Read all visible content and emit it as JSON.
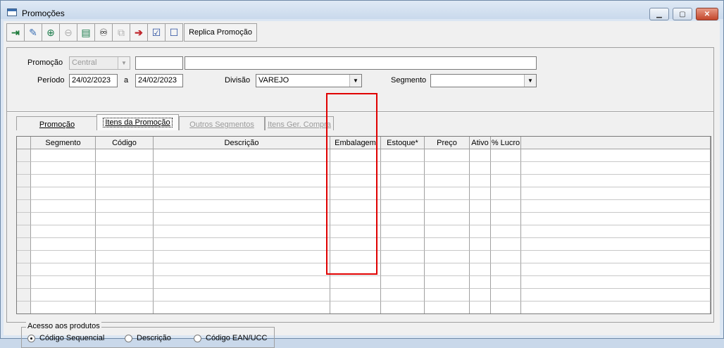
{
  "window": {
    "title": "Promoções"
  },
  "toolbar": {
    "buttons": [
      {
        "icon": "exit-door-icon",
        "glyph": "⇥"
      },
      {
        "icon": "eraser-icon",
        "glyph": "✎"
      },
      {
        "icon": "add-item-icon",
        "glyph": "⊕"
      },
      {
        "icon": "remove-item-icon",
        "glyph": "⊖"
      },
      {
        "icon": "spreadsheet-icon",
        "glyph": "▤"
      },
      {
        "icon": "binoculars-icon",
        "glyph": "♾"
      },
      {
        "icon": "copy-disabled-icon",
        "glyph": "⧉"
      },
      {
        "icon": "execute-arrow-icon",
        "glyph": "➔"
      },
      {
        "icon": "checklist-icon",
        "glyph": "☑"
      },
      {
        "icon": "unchecked-list-icon",
        "glyph": "☐"
      }
    ],
    "replica_label": "Replica Promoção"
  },
  "form": {
    "promocao_label": "Promoção",
    "promocao_value": "Central",
    "periodo_label": "Período",
    "periodo_start": "24/02/2023",
    "periodo_sep": "a",
    "periodo_end": "24/02/2023",
    "divisao_label": "Divisão",
    "divisao_value": "VAREJO",
    "segmento_label": "Segmento",
    "segmento_value": ""
  },
  "tabs": [
    {
      "label": "Promoção",
      "active": false,
      "enabled": true
    },
    {
      "label": "Itens da Promoção",
      "active": true,
      "enabled": true
    },
    {
      "label": "Outros Segmentos",
      "active": false,
      "enabled": false
    },
    {
      "label": "Itens Ger. Compra",
      "active": false,
      "enabled": false
    }
  ],
  "grid": {
    "columns": [
      "",
      "Segmento",
      "Código",
      "Descrição",
      "Embalagem",
      "Estoque*",
      "Preço",
      "Ativo",
      "% Lucro",
      ""
    ],
    "row_count": 13
  },
  "access": {
    "legend": "Acesso aos produtos",
    "options": [
      "Código Sequencial",
      "Descrição",
      "Código EAN/UCC"
    ],
    "selected": "Código Sequencial"
  },
  "colors": {
    "highlight": "#e00000",
    "titlebar": "#c9d9ec"
  }
}
